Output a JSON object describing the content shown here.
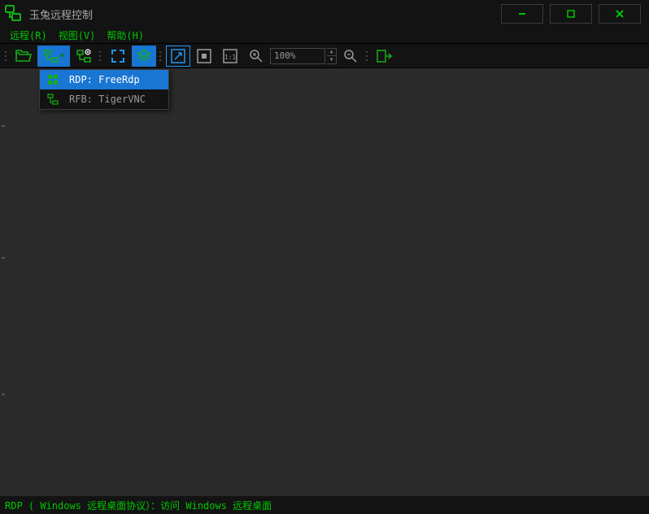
{
  "app": {
    "title": "玉兔远程控制"
  },
  "menu": {
    "remote": "远程(R)",
    "view": "视图(V)",
    "help": "帮助(H)"
  },
  "toolbar": {
    "zoom_value": "100%"
  },
  "popup": {
    "items": [
      {
        "label": "RDP: FreeRdp",
        "highlighted": true
      },
      {
        "label": "RFB: TigerVNC",
        "highlighted": false
      }
    ]
  },
  "status": {
    "text": "RDP ( Windows 远程桌面协议）：访问 Windows 远程桌面"
  }
}
